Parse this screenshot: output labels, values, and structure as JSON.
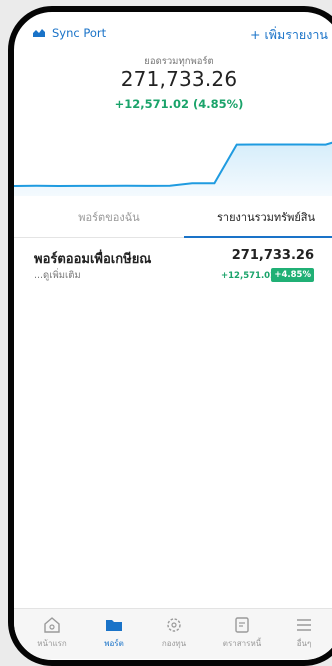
{
  "header": {
    "sync_label": "Sync Port",
    "add_report_label": "+ เพิ่มรายงาน"
  },
  "summary": {
    "label": "ยอดรวมทุกพอร์ต",
    "total": "271,733.26",
    "change": "+12,571.02 (4.85%)"
  },
  "chart_data": {
    "type": "area",
    "x": [
      0,
      1,
      2,
      3,
      4,
      5,
      6,
      7,
      8,
      9,
      10,
      11,
      12,
      13,
      14,
      15
    ],
    "series": [
      {
        "values": [
          259162,
          259200,
          259150,
          259180,
          259170,
          259210,
          259190,
          259200,
          259950,
          259960,
          271600,
          271650,
          271640,
          271650,
          271620,
          273600
        ]
      }
    ],
    "accent_color": "#1f9be0"
  },
  "tabs": [
    {
      "label": "พอร์ตของฉัน",
      "active": false
    },
    {
      "label": "รายงานรวมทรัพย์สิน",
      "active": true
    }
  ],
  "portfolio": {
    "name": "พอร์ตออมเพื่อเกษียณ",
    "more": "...ดูเพิ่มเติม",
    "value": "271,733.26",
    "change": "+12,571.02",
    "percent": "+4.85%"
  },
  "nav": {
    "items": [
      {
        "label": "หน้าแรก",
        "icon": "home-icon",
        "active": false
      },
      {
        "label": "พอร์ต",
        "icon": "folder-icon",
        "active": true
      },
      {
        "label": "กองทุน",
        "icon": "fund-icon",
        "active": false
      },
      {
        "label": "ตราสารหนี้",
        "icon": "bond-icon",
        "active": false
      },
      {
        "label": "อื่นๆ",
        "icon": "menu-icon",
        "active": false
      }
    ]
  }
}
